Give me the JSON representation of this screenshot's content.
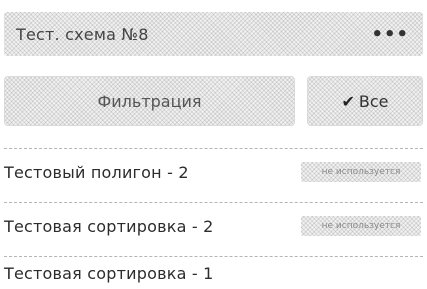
{
  "header": {
    "title": "Тест. схема №8",
    "menu_label": "•••"
  },
  "toolbar": {
    "filter_label": "Фильтрация",
    "all_check_icon": "✔",
    "all_label": "Все"
  },
  "rows": [
    {
      "label": "Тестовый полигон - 2",
      "status": "не используется"
    },
    {
      "label": "Тестовая сортировка - 2",
      "status": "не используется"
    },
    {
      "label": "Тестовая сортировка - 1",
      "status": ""
    }
  ]
}
